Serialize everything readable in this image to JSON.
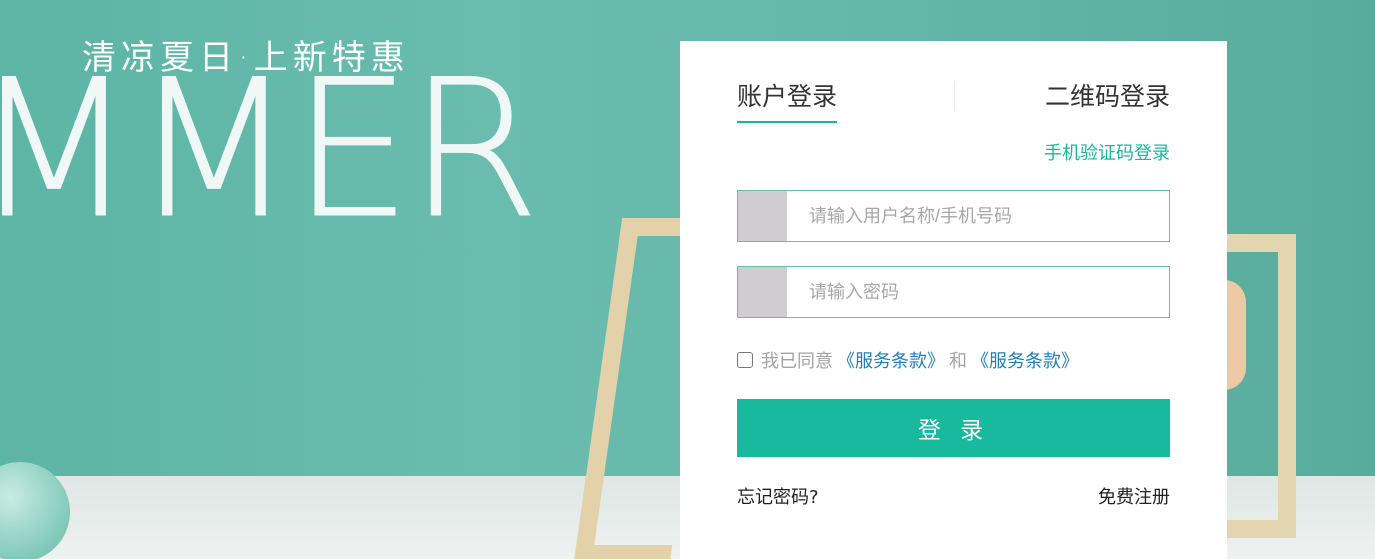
{
  "banner": {
    "slogan": "清凉夏日·上新特惠",
    "big_word": "MMER"
  },
  "login": {
    "tabs": [
      {
        "label": "账户登录",
        "active": true
      },
      {
        "label": "二维码登录",
        "active": false
      }
    ],
    "sms_link": "手机验证码登录",
    "username_placeholder": "请输入用户名称/手机号码",
    "password_placeholder": "请输入密码",
    "agree": {
      "prefix": "我已同意",
      "terms1": "《服务条款》",
      "and": "和",
      "terms2": "《服务条款》",
      "checked": false
    },
    "submit_label": "登 录",
    "forgot_label": "忘记密码?",
    "register_label": "免费注册"
  },
  "colors": {
    "accent": "#18b99d",
    "background_teal": "#66b8aa",
    "link_blue": "#1f7fb5"
  }
}
